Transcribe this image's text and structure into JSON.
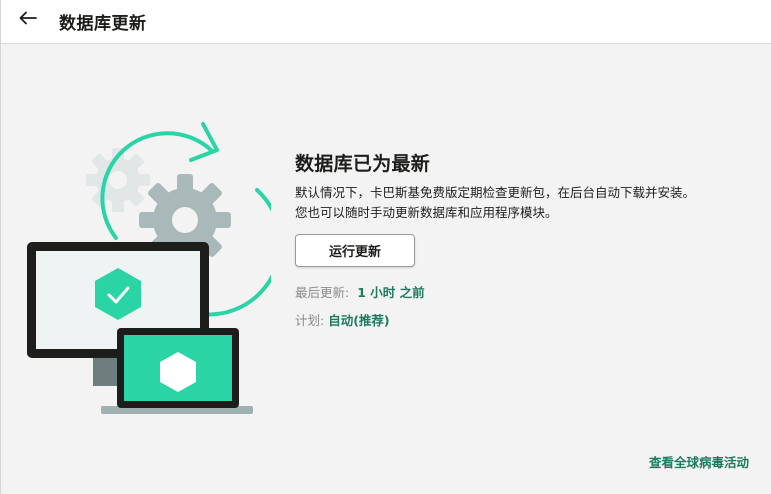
{
  "header": {
    "back_icon": "arrow-left-icon",
    "title": "数据库更新"
  },
  "illustration": {
    "icons": [
      "gear-icon",
      "refresh-arrows-icon",
      "monitor-icon",
      "check-icon",
      "laptop-icon",
      "hexagon-icon"
    ],
    "colors": {
      "accent": "#2bd4a5",
      "gear_light": "#e1e6e6",
      "gear_dark": "#a9b8b8",
      "device_frame": "#1d1d1b",
      "screen_light": "#eef4f4",
      "stand": "#9fb1b1"
    }
  },
  "main": {
    "status_title": "数据库已为最新",
    "description_line1": "默认情况下，卡巴斯基免费版定期检查更新包，在后台自动下载并安装。",
    "description_line2": "您也可以随时手动更新数据库和应用程序模块。",
    "run_update_button": "运行更新",
    "last_update_label": "最后更新:",
    "last_update_value": "1 小时 之前",
    "schedule_label": "计划:",
    "schedule_value": "自动(推荐)"
  },
  "footer": {
    "threat_activity_link": "查看全球病毒活动"
  },
  "colors": {
    "accent_text": "#1f7a5f",
    "background": "#f3f3f3",
    "header_bg": "#ffffff"
  }
}
